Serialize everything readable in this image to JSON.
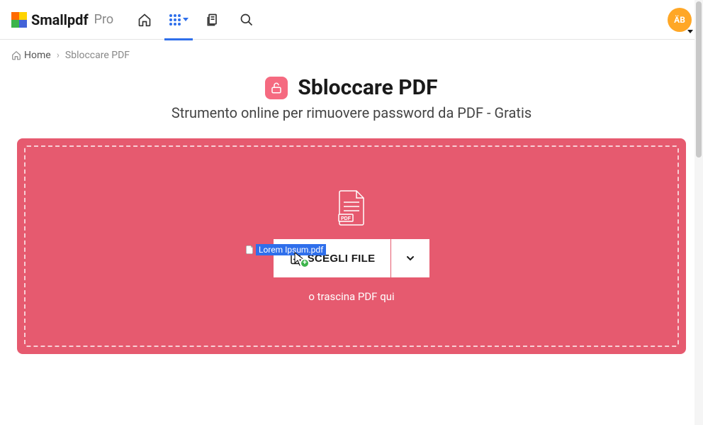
{
  "header": {
    "logo_text": "Smallpdf",
    "pro_text": "Pro",
    "avatar_initials": "ÄB"
  },
  "breadcrumb": {
    "home_label": "Home",
    "separator": "›",
    "current": "Sbloccare PDF"
  },
  "page": {
    "title": "Sbloccare PDF",
    "subtitle": "Strumento online per rimuovere password da PDF - Gratis",
    "pdf_badge_label": "PDF",
    "choose_file_label": "SCEGLI FILE",
    "drag_text": "o trascina PDF qui"
  },
  "dragging_file": {
    "file_name": "Lorem Ipsum.pdf"
  },
  "icons": {
    "home": "home-icon",
    "apps": "apps-grid-icon",
    "documents": "documents-icon",
    "search": "search-icon",
    "unlock": "unlock-icon",
    "chevron_down": "chevron-down-icon",
    "add_file": "add-file-icon",
    "pdf_document": "pdf-document-icon"
  },
  "colors": {
    "accent_blue": "#2f6feb",
    "dropzone_pink": "#e65a6f",
    "title_icon_pink": "#f56a80",
    "avatar_orange": "#ffa726",
    "plus_green": "#3cb44b"
  }
}
